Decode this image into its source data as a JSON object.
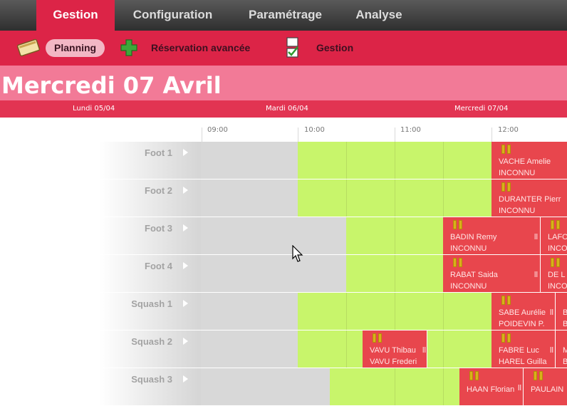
{
  "nav": {
    "tabs": [
      {
        "label": "Gestion"
      },
      {
        "label": "Configuration"
      },
      {
        "label": "Paramétrage"
      },
      {
        "label": "Analyse"
      }
    ]
  },
  "subnav": {
    "planning": "Planning",
    "reservation": "Réservation avancée",
    "gestion": "Gestion"
  },
  "day_title": "Mercredi 07 Avril",
  "days": [
    "Lundi 05/04",
    "Mardi 06/04",
    "Mercredi 07/04"
  ],
  "times": [
    "09:00",
    "10:00",
    "11:00",
    "12:00"
  ],
  "resources": [
    {
      "name": "Foot 1"
    },
    {
      "name": "Foot 2"
    },
    {
      "name": "Foot 3"
    },
    {
      "name": "Foot 4"
    },
    {
      "name": "Squash 1"
    },
    {
      "name": "Squash 2"
    },
    {
      "name": "Squash 3"
    }
  ],
  "bookings": [
    {
      "row": 0,
      "line1": "VACHE Amelie",
      "line2": "INCONNU"
    },
    {
      "row": 1,
      "line1": "DURANTER Pierr",
      "line2": "INCONNU"
    },
    {
      "row": 2,
      "line1": "BADIN Remy",
      "line2": "INCONNU"
    },
    {
      "row": 2,
      "line1": "LAFO",
      "line2": "INCO"
    },
    {
      "row": 3,
      "line1": "RABAT Saida",
      "line2": "INCONNU"
    },
    {
      "row": 3,
      "line1": "DE L",
      "line2": "INCO"
    },
    {
      "row": 4,
      "line1": "SABE Aurélie",
      "line2": "POIDEVIN P."
    },
    {
      "row": 4,
      "line1": "B",
      "line2": "B"
    },
    {
      "row": 5,
      "line1": "VAVU Thibau",
      "line2": "VAVU Frederi"
    },
    {
      "row": 5,
      "line1": "FABRE Luc",
      "line2": "HAREL Guilla"
    },
    {
      "row": 5,
      "line1": "M",
      "line2": "B"
    },
    {
      "row": 6,
      "line1": "HAAN Florian",
      "line2": ""
    },
    {
      "row": 6,
      "line1": "PAULAIN",
      "line2": ""
    }
  ],
  "colors": {
    "accent": "#dc2447",
    "free": "#c8f56b",
    "closed": "#d8d8d8",
    "booked": "#e8464d"
  }
}
